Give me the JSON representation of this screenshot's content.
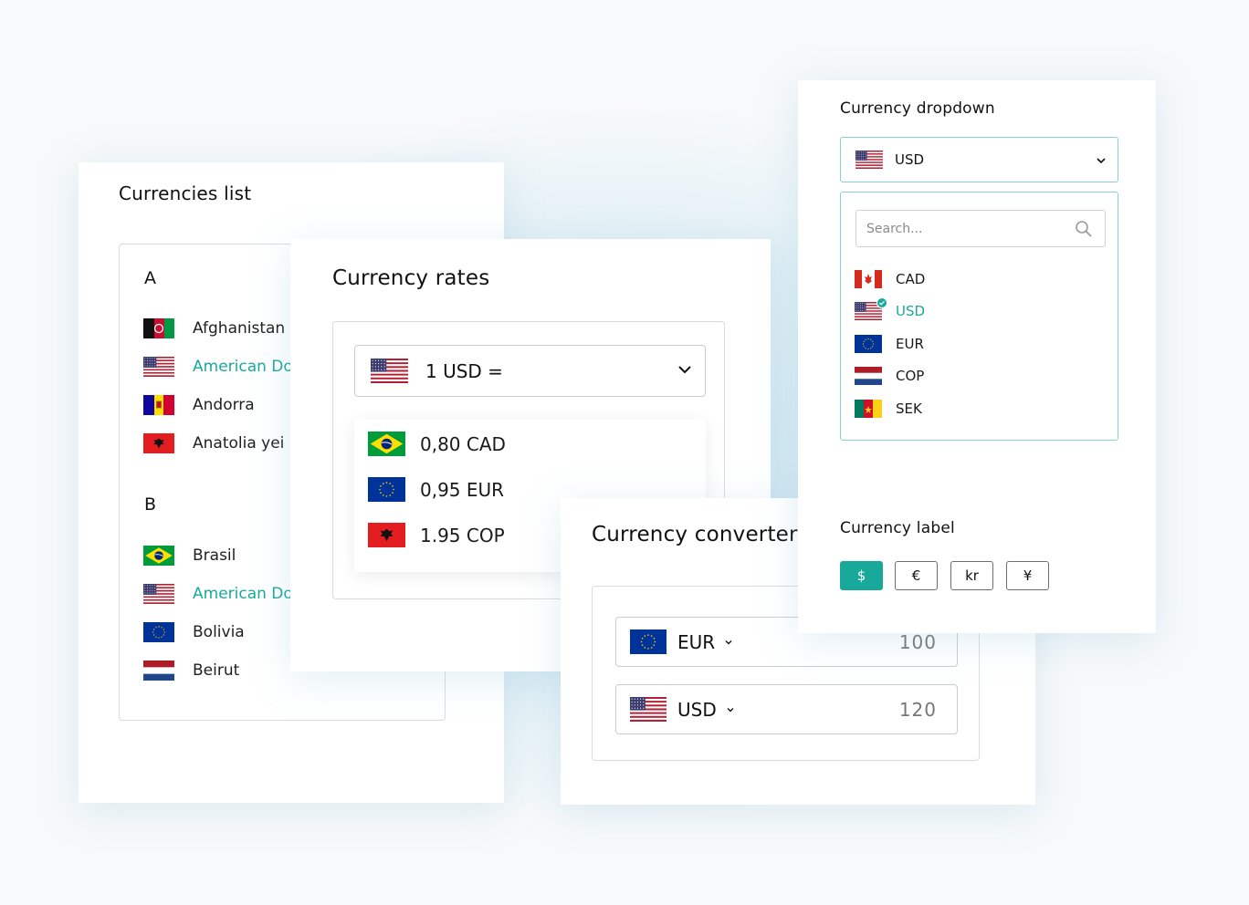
{
  "colors": {
    "accent": "#19a99a",
    "border": "#d8dcdf",
    "focus_border": "#86d4c5"
  },
  "currencies_list": {
    "title": "Currencies list",
    "groups": [
      {
        "letter": "A",
        "items": [
          {
            "label": "Afghanistan D",
            "flag": "afghanistan-flag-icon",
            "active": false
          },
          {
            "label": "American Dol",
            "flag": "usa-flag-icon",
            "active": true
          },
          {
            "label": "Andorra",
            "flag": "andorra-flag-icon",
            "active": false
          },
          {
            "label": "Anatolia yei",
            "flag": "albania-flag-icon",
            "active": false
          }
        ]
      },
      {
        "letter": "B",
        "items": [
          {
            "label": "Brasil",
            "flag": "brazil-flag-icon",
            "active": false
          },
          {
            "label": "American Dol",
            "flag": "usa-flag-icon",
            "active": true
          },
          {
            "label": "Bolivia",
            "flag": "eu-flag-icon",
            "active": false
          },
          {
            "label": "Beirut",
            "flag": "netherlands-flag-icon",
            "active": false
          }
        ]
      }
    ]
  },
  "currency_rates": {
    "title": "Currency rates",
    "base": "1 USD =",
    "rates": [
      {
        "label": "0,80 CAD",
        "flag": "brazil-flag-icon"
      },
      {
        "label": "0,95 EUR",
        "flag": "eu-flag-icon"
      },
      {
        "label": "1.95 COP",
        "flag": "albania-flag-icon"
      }
    ]
  },
  "currency_converter": {
    "title": "Currency converter",
    "rows": [
      {
        "code": "EUR",
        "amount": "100",
        "flag": "eu-flag-icon"
      },
      {
        "code": "USD",
        "amount": "120",
        "flag": "usa-flag-icon"
      }
    ]
  },
  "currency_dropdown": {
    "title": "Currency dropdown",
    "selected": "USD",
    "search_placeholder": "Search...",
    "options": [
      {
        "code": "CAD",
        "flag": "canada-flag-icon",
        "selected": false
      },
      {
        "code": "USD",
        "flag": "usa-flag-icon",
        "selected": true
      },
      {
        "code": "EUR",
        "flag": "eu-flag-icon",
        "selected": false
      },
      {
        "code": "COP",
        "flag": "netherlands-flag-icon",
        "selected": false
      },
      {
        "code": "SEK",
        "flag": "cameroon-flag-icon",
        "selected": false
      }
    ]
  },
  "currency_label": {
    "title": "Currency label",
    "symbols": [
      "$",
      "€",
      "kr",
      "¥"
    ],
    "active_index": 0
  }
}
